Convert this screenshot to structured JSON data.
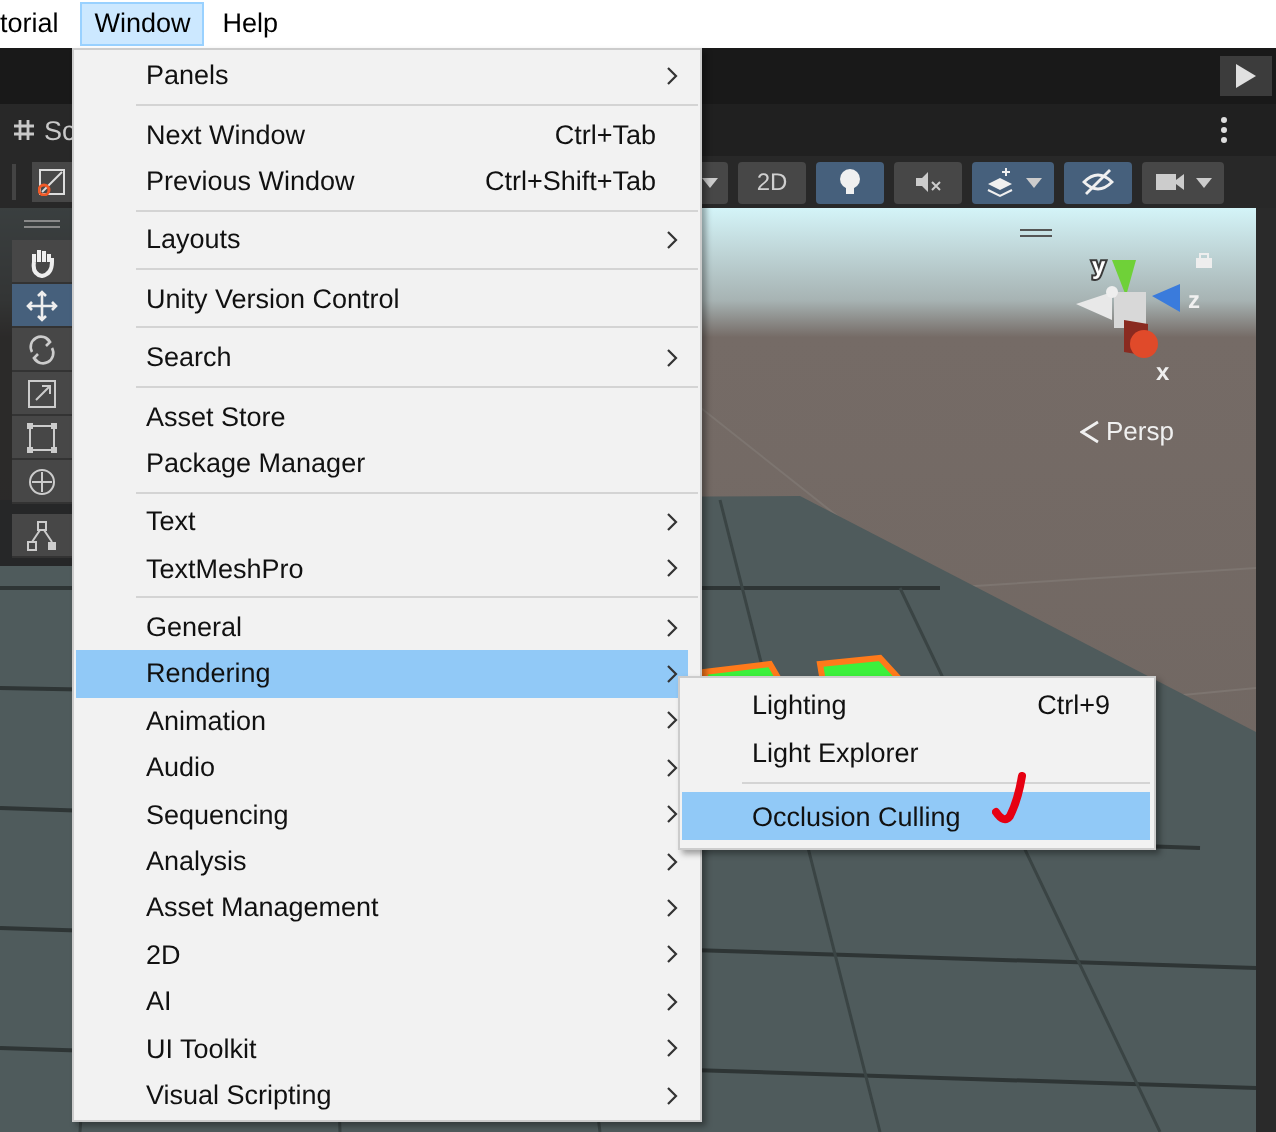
{
  "menubar": {
    "items": [
      {
        "label": "torial",
        "selected": false
      },
      {
        "label": "Window",
        "selected": true
      },
      {
        "label": "Help",
        "selected": false
      }
    ]
  },
  "scene_tab": {
    "label": "Sc"
  },
  "scene_toolbar": {
    "buttons": [
      {
        "on": false,
        "dropdown": true
      },
      {
        "label": "2D",
        "on": false,
        "dropdown": false
      },
      {
        "on": true,
        "dropdown": false
      },
      {
        "on": false,
        "dropdown": false
      },
      {
        "on": true,
        "dropdown": true
      },
      {
        "on": true,
        "dropdown": false
      },
      {
        "on": false,
        "dropdown": true
      }
    ]
  },
  "tools": [
    {
      "selected": false
    },
    {
      "selected": true
    },
    {
      "selected": false
    },
    {
      "selected": false
    },
    {
      "selected": false
    },
    {
      "selected": false
    },
    {
      "selected": false
    }
  ],
  "scene": {
    "view_label": "Persp",
    "axes": [
      "y",
      "z",
      "x"
    ]
  },
  "window_menu": {
    "items": [
      {
        "kind": "item",
        "label": "Panels",
        "submenu": true,
        "selected": false
      },
      {
        "kind": "separator"
      },
      {
        "kind": "item",
        "label": "Next Window",
        "shortcut": "Ctrl+Tab",
        "submenu": false,
        "selected": false
      },
      {
        "kind": "item",
        "label": "Previous Window",
        "shortcut": "Ctrl+Shift+Tab",
        "submenu": false,
        "selected": false
      },
      {
        "kind": "separator"
      },
      {
        "kind": "item",
        "label": "Layouts",
        "submenu": true,
        "selected": false
      },
      {
        "kind": "separator"
      },
      {
        "kind": "item",
        "label": "Unity Version Control",
        "submenu": false,
        "selected": false
      },
      {
        "kind": "separator"
      },
      {
        "kind": "item",
        "label": "Search",
        "submenu": true,
        "selected": false
      },
      {
        "kind": "separator"
      },
      {
        "kind": "item",
        "label": "Asset Store",
        "submenu": false,
        "selected": false
      },
      {
        "kind": "item",
        "label": "Package Manager",
        "submenu": false,
        "selected": false
      },
      {
        "kind": "separator"
      },
      {
        "kind": "item",
        "label": "Text",
        "submenu": true,
        "selected": false
      },
      {
        "kind": "item",
        "label": "TextMeshPro",
        "submenu": true,
        "selected": false
      },
      {
        "kind": "separator"
      },
      {
        "kind": "item",
        "label": "General",
        "submenu": true,
        "selected": false
      },
      {
        "kind": "item",
        "label": "Rendering",
        "submenu": true,
        "selected": true
      },
      {
        "kind": "item",
        "label": "Animation",
        "submenu": true,
        "selected": false
      },
      {
        "kind": "item",
        "label": "Audio",
        "submenu": true,
        "selected": false
      },
      {
        "kind": "item",
        "label": "Sequencing",
        "submenu": true,
        "selected": false
      },
      {
        "kind": "item",
        "label": "Analysis",
        "submenu": true,
        "selected": false
      },
      {
        "kind": "item",
        "label": "Asset Management",
        "submenu": true,
        "selected": false
      },
      {
        "kind": "item",
        "label": "2D",
        "submenu": true,
        "selected": false
      },
      {
        "kind": "item",
        "label": "AI",
        "submenu": true,
        "selected": false
      },
      {
        "kind": "item",
        "label": "UI Toolkit",
        "submenu": true,
        "selected": false
      },
      {
        "kind": "item",
        "label": "Visual Scripting",
        "submenu": true,
        "selected": false
      }
    ]
  },
  "rendering_submenu": {
    "items": [
      {
        "kind": "item",
        "label": "Lighting",
        "shortcut": "Ctrl+9",
        "selected": false
      },
      {
        "kind": "item",
        "label": "Light Explorer",
        "selected": false
      },
      {
        "kind": "separator"
      },
      {
        "kind": "item",
        "label": "Occlusion Culling",
        "selected": true
      }
    ]
  }
}
